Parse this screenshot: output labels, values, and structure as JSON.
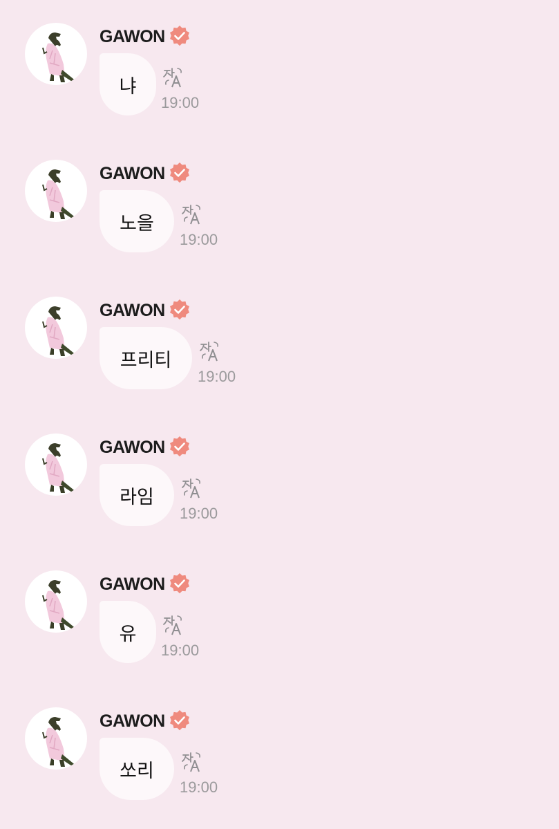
{
  "theme": {
    "background": "#f7e8ef",
    "bubble_color": "#fdf8fa",
    "verified_badge_color": "#ef8a7e",
    "timestamp_color": "#9b9a9c"
  },
  "icons": {
    "avatar": "dinosaur-avatar-icon",
    "verified": "verified-badge-icon",
    "translate": "translate-icon"
  },
  "messages": [
    {
      "sender": "GAWON",
      "text": "냐",
      "time": "19:00"
    },
    {
      "sender": "GAWON",
      "text": "노을",
      "time": "19:00"
    },
    {
      "sender": "GAWON",
      "text": "프리티",
      "time": "19:00"
    },
    {
      "sender": "GAWON",
      "text": "라임",
      "time": "19:00"
    },
    {
      "sender": "GAWON",
      "text": "유",
      "time": "19:00"
    },
    {
      "sender": "GAWON",
      "text": "쏘리",
      "time": "19:00"
    }
  ]
}
